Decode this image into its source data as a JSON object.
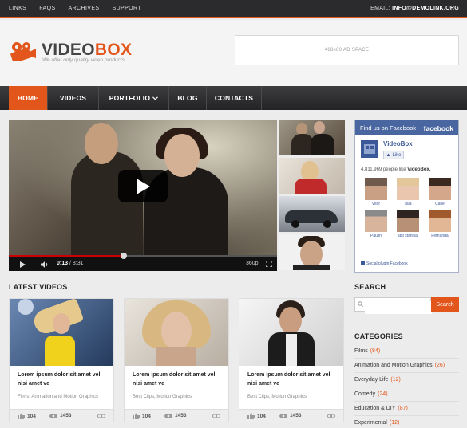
{
  "topbar": {
    "links": [
      "LINKS",
      "FAQS",
      "ARCHIVES",
      "SUPPORT"
    ],
    "email_label": "EMAIL:",
    "email_value": "INFO@DEMOLINK.ORG"
  },
  "header": {
    "logo_part1": "VIDEO",
    "logo_part2": "BOX",
    "tagline": "We offer only quality video products",
    "ad_text": "468x60 AD SPACE"
  },
  "nav": {
    "items": [
      "HOME",
      "VIDEOS",
      "PORTFOLIO",
      "BLOG",
      "CONTACTS"
    ],
    "active": "HOME"
  },
  "player": {
    "current_time": "0:13",
    "total_time": "8:31",
    "quality": "360p",
    "progress": 0.43
  },
  "facebook": {
    "header_left": "Find us on Facebook",
    "header_right": "facebook",
    "page_name": "VideoBox",
    "like_label": "Like",
    "count_text": "4,811,969 people like",
    "count_page": "VideoBox.",
    "faces": [
      "Vitor",
      "Tala",
      "Catie",
      "Paulin",
      "abil stanisal",
      "Fernanda"
    ],
    "plugin_text": "Social plugin Facebook"
  },
  "latest": {
    "title": "LATEST VIDEOS",
    "cards": [
      {
        "title": "Lorem ipsum dolor sit amet vel nisi amet ve",
        "category": "Films, Animation and Motion Graphics",
        "likes": "104",
        "views": "1453"
      },
      {
        "title": "Lorem ipsum dolor sit amet vel nisi amet ve",
        "category": "Best Clips, Motion Graphics",
        "likes": "104",
        "views": "1453"
      },
      {
        "title": "Lorem ipsum dolor sit amet vel nisi amet ve",
        "category": "Best Clips, Motion Graphics",
        "likes": "104",
        "views": "1453"
      }
    ]
  },
  "search": {
    "title": "SEARCH",
    "placeholder": "",
    "button": "Search"
  },
  "categories": {
    "title": "CATEGORIES",
    "items": [
      {
        "name": "Films",
        "count": "(84)"
      },
      {
        "name": "Animation and Motion Graphics",
        "count": "(26)"
      },
      {
        "name": "Everyday Life",
        "count": "(12)"
      },
      {
        "name": "Comedy",
        "count": "(24)"
      },
      {
        "name": "Education & DIY",
        "count": "(87)"
      },
      {
        "name": "Experimental",
        "count": "(12)"
      }
    ]
  },
  "colors": {
    "accent": "#e2561c",
    "dark": "#2b2b2d",
    "facebook": "#4a66a0"
  }
}
